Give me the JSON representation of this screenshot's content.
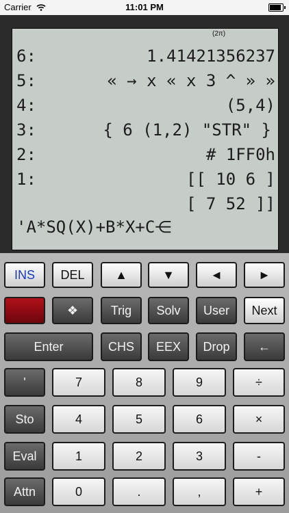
{
  "status_bar": {
    "carrier": "Carrier",
    "time": "11:01 PM",
    "wifi_icon": "wifi-icon",
    "battery_icon": "battery-icon"
  },
  "display": {
    "annunciator": "(2π)",
    "stack": [
      {
        "level": "6:",
        "value": "1.41421356237"
      },
      {
        "level": "5:",
        "value": "« → x « x 3 ^ » »"
      },
      {
        "level": "4:",
        "value": "(5,4)"
      },
      {
        "level": "3:",
        "value": "{ 6 (1,2) \"STR\" }"
      },
      {
        "level": "2:",
        "value": "# 1FF0h"
      },
      {
        "level": "1:",
        "value": "[[ 10 6 ]"
      },
      {
        "level": "",
        "value": "[ 7 52 ]]"
      }
    ],
    "edit_line": "'A*SQ(X)+B*X+C",
    "cursor_glyph": "⋲"
  },
  "keys": {
    "ins": "INS",
    "del": "DEL",
    "up": "▲",
    "down": "▼",
    "left": "◄",
    "right": "►",
    "shift_symbol": "❖",
    "trig": "Trig",
    "solv": "Solv",
    "user": "User",
    "next": "Next",
    "enter": "Enter",
    "chs": "CHS",
    "eex": "EEX",
    "drop": "Drop",
    "backspace": "←",
    "quote": "'",
    "sto": "Sto",
    "eval": "Eval",
    "attn": "Attn",
    "n7": "7",
    "n8": "8",
    "n9": "9",
    "divide": "÷",
    "n4": "4",
    "n5": "5",
    "n6": "6",
    "multiply": "×",
    "n1": "1",
    "n2": "2",
    "n3": "3",
    "minus": "-",
    "n0": "0",
    "dot": ".",
    "comma": ",",
    "plus": "+"
  },
  "colors": {
    "lcd": "#c6ccc8",
    "bezel": "#2b2b2b",
    "red_key": "#b0101a",
    "ins_text": "#1a3ab8"
  }
}
